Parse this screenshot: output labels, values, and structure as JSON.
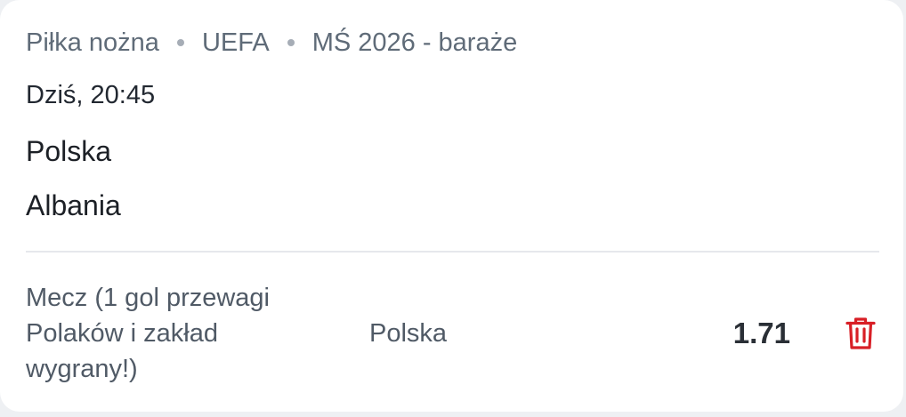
{
  "event": {
    "breadcrumb": [
      "Piłka nożna",
      "UEFA",
      "MŚ 2026 - baraże"
    ],
    "time": "Dziś, 20:45",
    "home_team": "Polska",
    "away_team": "Albania"
  },
  "bet": {
    "market": "Mecz (1 gol przewagi Polaków i zakład wygrany!)",
    "selection": "Polska",
    "odds": "1.71",
    "delete_icon": "trash-icon"
  },
  "colors": {
    "accent_delete": "#d81f26",
    "card_background": "#ffffff",
    "page_background": "#eef0f3"
  }
}
